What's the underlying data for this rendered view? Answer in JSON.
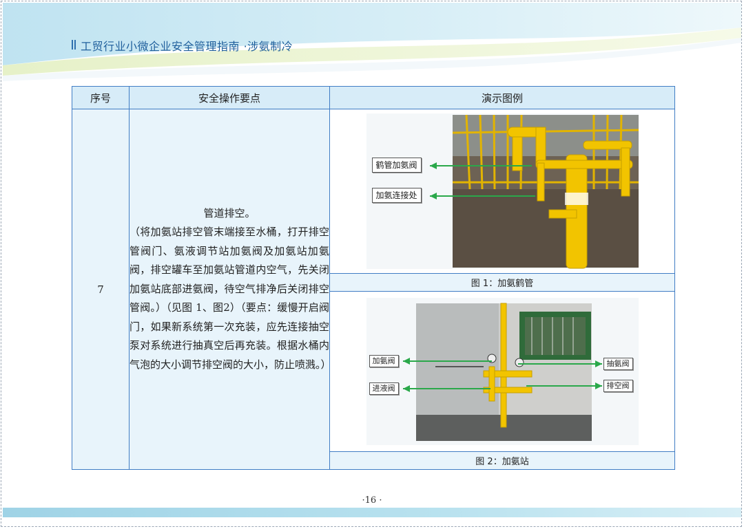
{
  "header": {
    "title": "工贸行业小微企业安全管理指南 ·涉氨制冷"
  },
  "table": {
    "columns": [
      "序号",
      "安全操作要点",
      "演示图例"
    ],
    "row": {
      "seq": "7",
      "steps_title": "管道排空。",
      "steps_body": "（将加氨站排空管末端接至水桶，打开排空管阀门、氨液调节站加氨阀及加氨站加氨阀，排空罐车至加氨站管道内空气，先关闭加氨站底部进氨阀，待空气排净后关闭排空管阀。）（见图 1、图2）（要点：缓慢开启阀门，如果新系统第一次充装，应先连接抽空泵对系统进行抽真空后再充装。根据水桶内气泡的大小调节排空阀的大小，防止喷溅。）"
    },
    "figure1": {
      "caption": "图 1：加氨鹤管",
      "labels": [
        "鹤管加氨阀",
        "加氨连接处"
      ]
    },
    "figure2": {
      "caption": "图 2：加氨站",
      "labels_left": [
        "加氨阀",
        "进液阀"
      ],
      "labels_right": [
        "抽氨阀",
        "排空阀"
      ]
    }
  },
  "footer": {
    "page_number": "·16 ·"
  },
  "colors": {
    "table_border": "#3f7cc4",
    "header_fill": "#d7ecf8",
    "cell_fill": "#e8f4fb",
    "arrow_green": "#2aa84a",
    "pipe_yellow": "#f2c400"
  }
}
